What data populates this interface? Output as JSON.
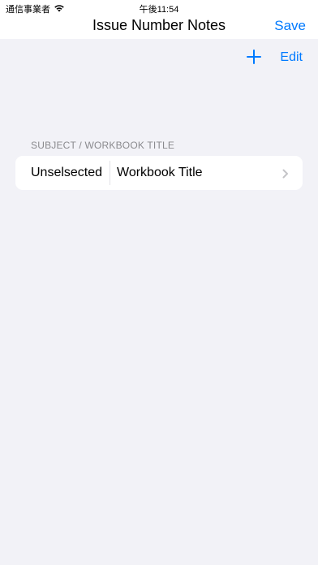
{
  "status_bar": {
    "carrier": "通信事業者",
    "time": "午後11:54"
  },
  "nav": {
    "title": "Issue Number Notes",
    "save_label": "Save"
  },
  "toolbar": {
    "add_icon": "plus-icon",
    "edit_label": "Edit"
  },
  "section": {
    "header": "SUBJECT / WORKBOOK TITLE",
    "rows": [
      {
        "subject": "Unselsected",
        "workbook_title": "Workbook Title"
      }
    ]
  },
  "colors": {
    "accent": "#007aff",
    "background": "#f2f2f7",
    "card": "#ffffff",
    "secondary_text": "#8a8a8e"
  }
}
